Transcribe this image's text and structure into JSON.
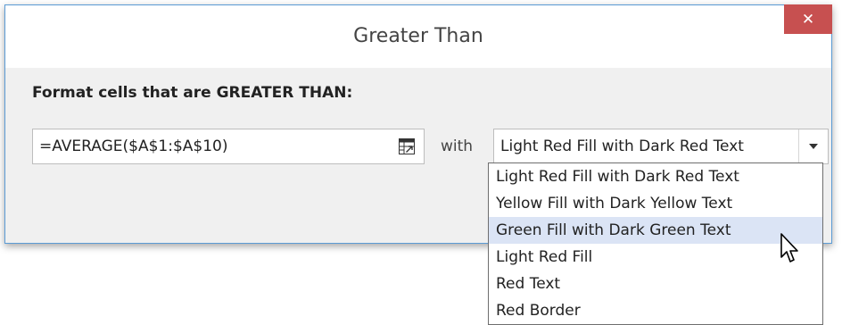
{
  "dialog": {
    "title": "Greater Than",
    "close_icon": "close-x-icon",
    "close_glyph": "✕",
    "prompt": "Format cells that are GREATER THAN:",
    "formula_value": "=AVERAGE($A$1:$A$10)",
    "range_picker_icon": "collapse-dialog-icon",
    "with_label": "with",
    "format_select": {
      "selected": "Light Red Fill with Dark Red Text",
      "options": [
        "Light Red Fill with Dark Red Text",
        "Yellow Fill with Dark Yellow Text",
        "Green Fill with Dark Green Text",
        "Light Red Fill",
        "Red Text",
        "Red Border"
      ],
      "hovered_index": 2
    }
  },
  "colors": {
    "close_button": "#c75050",
    "dialog_border": "#5b9bd5",
    "hover_highlight": "#dbe4f5",
    "dialog_background": "#f0f0f0"
  }
}
